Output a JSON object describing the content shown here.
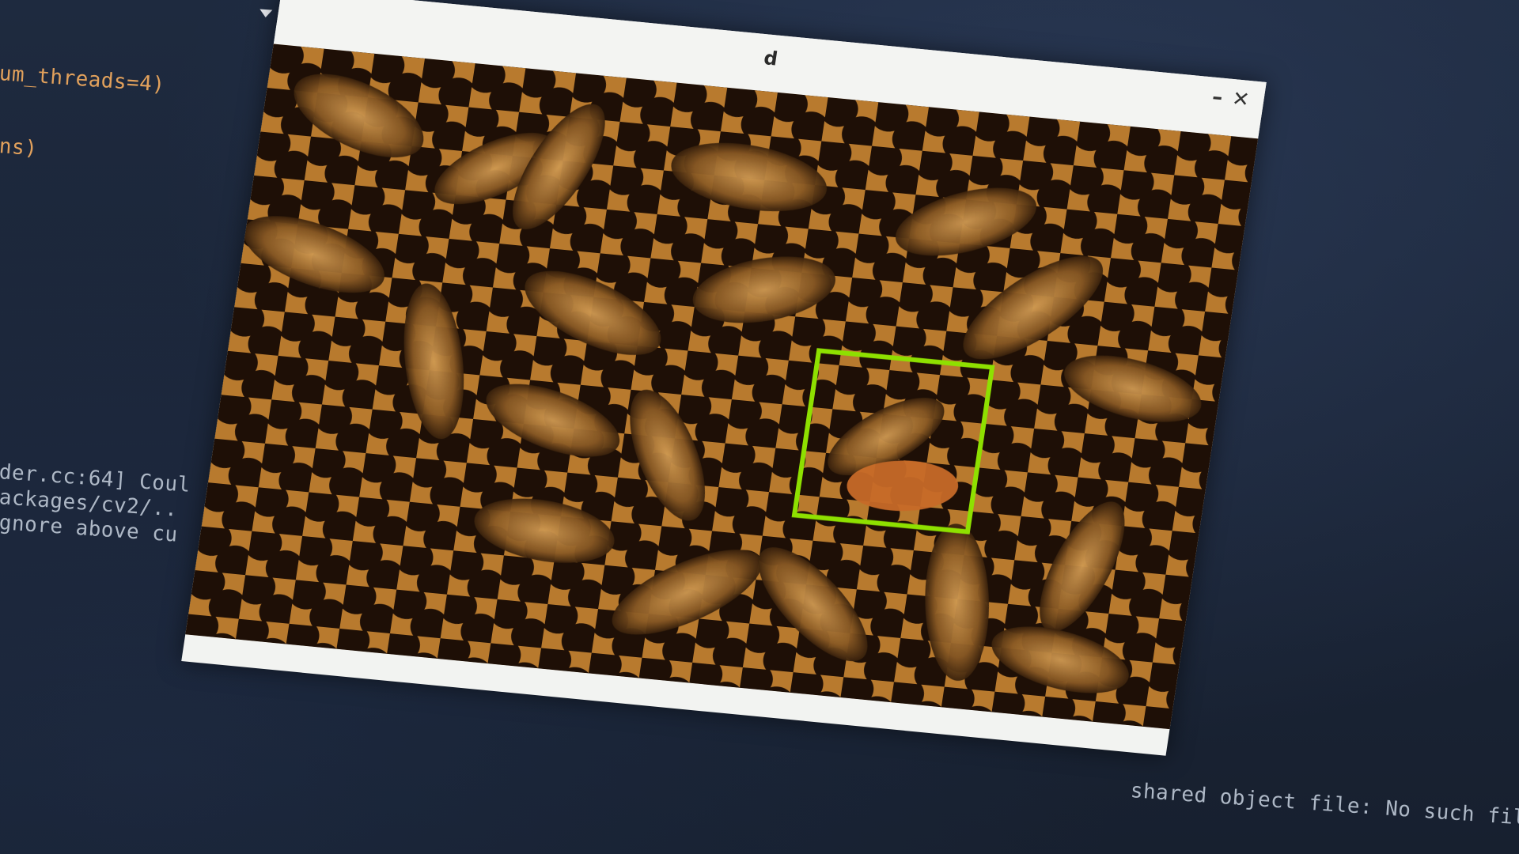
{
  "window": {
    "title": "d",
    "minimize_glyph": "–",
    "close_glyph": "✕"
  },
  "terminal": {
    "lines": [
      "um_threads=4)",
      "ns)",
      "der.cc:64] Coul",
      "ackages/cv2/..",
      "gnore above cu",
      "shared object file: No such file"
    ]
  },
  "image": {
    "subject": "honeybees on honeycomb",
    "detection_box_color": "#8ee000"
  },
  "icons": {
    "menu": "chevron-down-icon",
    "minimize": "minimize-icon",
    "close": "close-icon"
  }
}
